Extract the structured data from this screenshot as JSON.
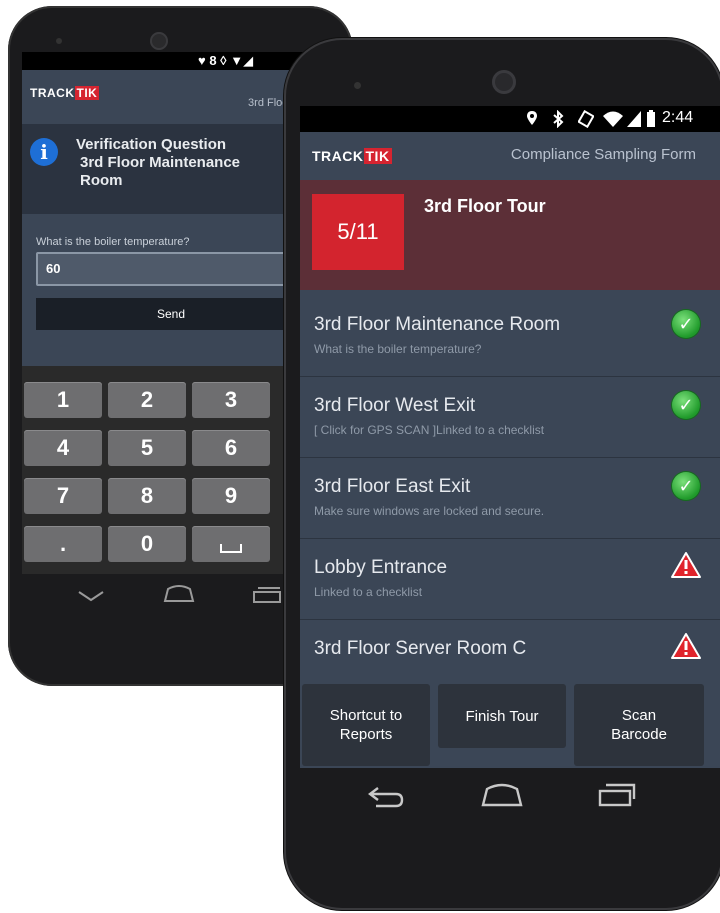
{
  "back_phone": {
    "status_icons": "♥ 8 ◊ ▼◢",
    "logo_track": "TRACK",
    "logo_tik": "TIK",
    "header_line1": "Verification Q",
    "header_line2": "3rd Floor Maintenanc",
    "verification_title": "Verification Question",
    "verification_location": "3rd Floor Maintenance Room",
    "question_label": "What is the boiler temperature?",
    "answer_value": "60",
    "send_label": "Send",
    "keys": [
      "1",
      "2",
      "3",
      "4",
      "5",
      "6",
      "7",
      "8",
      "9",
      ".",
      "0",
      "␣"
    ]
  },
  "front_phone": {
    "status_time": "2:44",
    "logo_track": "TRACK",
    "logo_tik": "TIK",
    "form_title": "Compliance Sampling Form",
    "tour_counter": "5/11",
    "tour_title": "3rd Floor Tour",
    "checkpoints": [
      {
        "title": "3rd Floor Maintenance Room",
        "subtitle": "What is the boiler temperature?",
        "status": "complete"
      },
      {
        "title": "3rd Floor West Exit",
        "subtitle": "[ Click for GPS SCAN ]Linked to a checklist",
        "status": "complete"
      },
      {
        "title": "3rd Floor East Exit",
        "subtitle": "Make sure windows are locked and secure.",
        "status": "complete"
      },
      {
        "title": "Lobby Entrance",
        "subtitle": "Linked to a checklist",
        "status": "warning"
      },
      {
        "title": "3rd Floor Server Room C",
        "subtitle": "",
        "status": "warning"
      }
    ],
    "buttons": {
      "shortcut_line1": "Shortcut to",
      "shortcut_line2": "Reports",
      "finish": "Finish Tour",
      "scan_line1": "Scan",
      "scan_line2": "Barcode"
    }
  },
  "colors": {
    "screen_bg": "#3b4656",
    "brand_red": "#d3242e",
    "tour_band": "#5c2f37",
    "button_bg": "#2d333c",
    "ok_green": "#1f9a2a",
    "warn_red": "#e0242c"
  }
}
